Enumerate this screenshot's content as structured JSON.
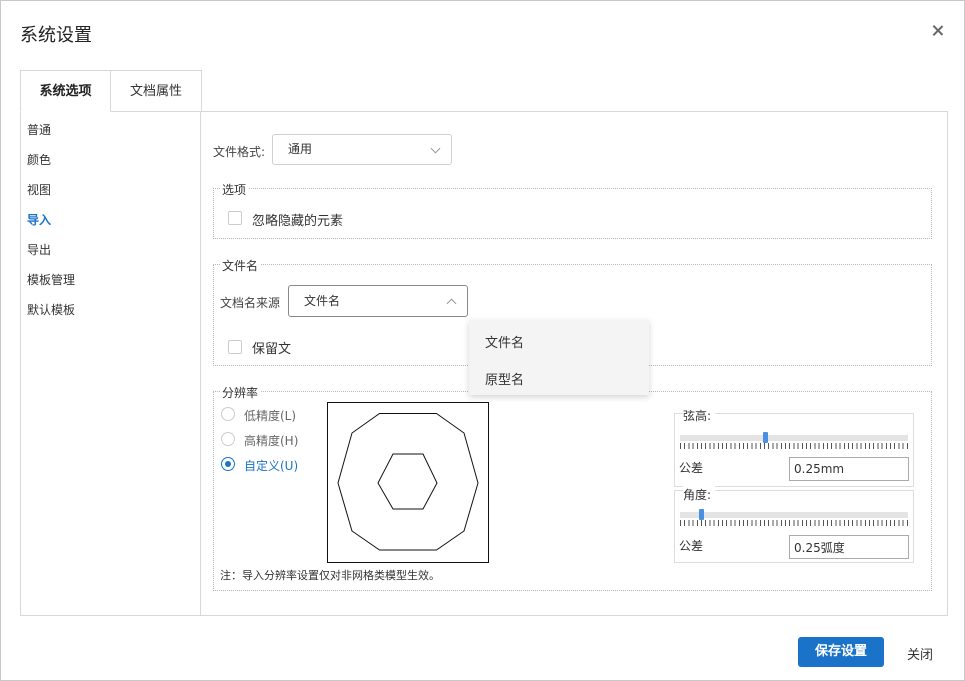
{
  "dialog": {
    "title": "系统设置"
  },
  "tabs": [
    {
      "label": "系统选项",
      "active": true
    },
    {
      "label": "文档属性",
      "active": false
    }
  ],
  "sidebar": {
    "items": [
      {
        "label": "普通"
      },
      {
        "label": "颜色"
      },
      {
        "label": "视图"
      },
      {
        "label": "导入",
        "active": true
      },
      {
        "label": "导出"
      },
      {
        "label": "模板管理"
      },
      {
        "label": "默认模板"
      }
    ]
  },
  "file_format": {
    "label": "文件格式:",
    "value": "通用"
  },
  "options_group": {
    "legend": "选项",
    "ignore_hidden": {
      "label": "忽略隐藏的元素",
      "checked": false
    }
  },
  "filename_group": {
    "legend": "文件名",
    "source_label": "文档名来源",
    "source_value": "文件名",
    "keep_label_visible": "保留文",
    "dropdown_options": [
      "文件名",
      "原型名"
    ]
  },
  "resolution_group": {
    "legend": "分辨率",
    "options": [
      {
        "label": "低精度(L)",
        "selected": false
      },
      {
        "label": "高精度(H)",
        "selected": false
      },
      {
        "label": "自定义(U)",
        "selected": true
      }
    ],
    "chord_height": {
      "legend": "弦高:",
      "slider_fraction": 0.37,
      "tolerance_label": "公差",
      "tolerance_value": "0.25mm"
    },
    "angle": {
      "legend": "角度:",
      "slider_fraction": 0.09,
      "tolerance_label": "公差",
      "tolerance_value": "0.25弧度"
    },
    "note": "注：导入分辨率设置仅对非网格类模型生效。"
  },
  "footer": {
    "save_label": "保存设置",
    "close_label": "关闭"
  },
  "colors": {
    "accent": "#1a73c9",
    "slider_thumb": "#4a90e2"
  }
}
